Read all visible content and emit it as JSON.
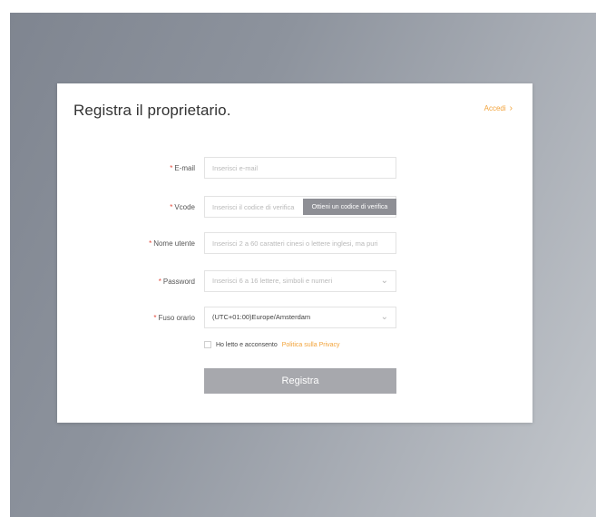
{
  "page": {
    "title": "Registra il proprietario.",
    "login_link": "Accedi"
  },
  "form": {
    "email": {
      "label": "E-mail",
      "placeholder": "Inserisci e-mail",
      "value": ""
    },
    "code": {
      "label": "Vcode",
      "placeholder": "Inserisci il codice di verifica",
      "value": "",
      "button_label": "Ottieni un codice di verifica"
    },
    "username": {
      "label": "Nome utente",
      "placeholder": "Inserisci 2 a 60 caratteri cinesi o lettere inglesi, ma puri",
      "value": ""
    },
    "password": {
      "label": "Password",
      "placeholder": "Inserisci 6 a 16 lettere, simboli e numeri"
    },
    "timezone": {
      "label": "Fuso orario",
      "selected": "(UTC+01:00)Europe/Amsterdam"
    },
    "agreement": {
      "text": "Ho letto e acconsento",
      "link_text": "Politica sulla Privacy",
      "checked": false
    },
    "submit_label": "Registra"
  },
  "icons": {
    "login_chevron": "chevron-right-icon",
    "password_chevron": "chevron-down-icon",
    "timezone_chevron": "chevron-down-icon"
  },
  "colors": {
    "accent": "#f2a33a",
    "required": "#e24a3b",
    "button_disabled": "#a7a8ad",
    "code_button": "#8e8f95"
  }
}
